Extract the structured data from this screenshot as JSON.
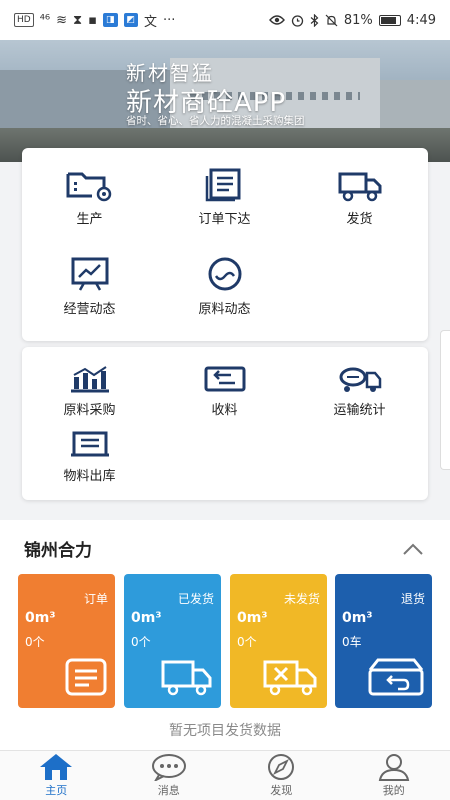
{
  "status_bar": {
    "left_chips": [
      "HD",
      "⁴⁶",
      "≋",
      "⧗",
      "▪",
      "◨",
      "◩",
      "文",
      "···"
    ],
    "battery": "81%",
    "time": "4:49"
  },
  "banner": {
    "title_line1": "新材智猛",
    "title_line2": "新材商砼APP",
    "subtitle": "省时、省心、省人力的混凝土采购集团"
  },
  "grid1": [
    {
      "label": "生产",
      "icon": "folder-gear-icon"
    },
    {
      "label": "订单下达",
      "icon": "order-list-icon"
    },
    {
      "label": "发货",
      "icon": "truck-icon"
    },
    {
      "label": "经营动态",
      "icon": "chart-board-icon"
    },
    {
      "label": "原料动态",
      "icon": "material-circle-icon"
    }
  ],
  "grid2": [
    {
      "label": "原料采购",
      "icon": "bar-chart-icon"
    },
    {
      "label": "收料",
      "icon": "receive-icon"
    },
    {
      "label": "运输统计",
      "icon": "mixer-truck-icon"
    },
    {
      "label": "物料出库",
      "icon": "outbound-icon"
    }
  ],
  "project": {
    "name": "锦州合力",
    "stats": [
      {
        "label": "订单",
        "volume": "0m³",
        "count": "0个",
        "icon": "order-doc-icon"
      },
      {
        "label": "已发货",
        "volume": "0m³",
        "count": "0个",
        "icon": "shipped-truck-icon"
      },
      {
        "label": "未发货",
        "volume": "0m³",
        "count": "0个",
        "icon": "unshipped-truck-icon"
      },
      {
        "label": "退货",
        "volume": "0m³",
        "count": "0车",
        "icon": "return-box-icon"
      }
    ],
    "empty_note": "暂无项目发货数据"
  },
  "nav": [
    {
      "label": "主页",
      "icon": "home-icon",
      "active": true
    },
    {
      "label": "消息",
      "icon": "message-icon",
      "active": false
    },
    {
      "label": "发现",
      "icon": "compass-icon",
      "active": false
    },
    {
      "label": "我的",
      "icon": "user-icon",
      "active": false
    }
  ],
  "colors": {
    "primary_blue": "#1d6fc8",
    "icon_navy": "#1f3a68",
    "orange": "#f07e31",
    "sky": "#2e9bdb",
    "yellow": "#f1b826",
    "dark_blue": "#1d5fad"
  }
}
